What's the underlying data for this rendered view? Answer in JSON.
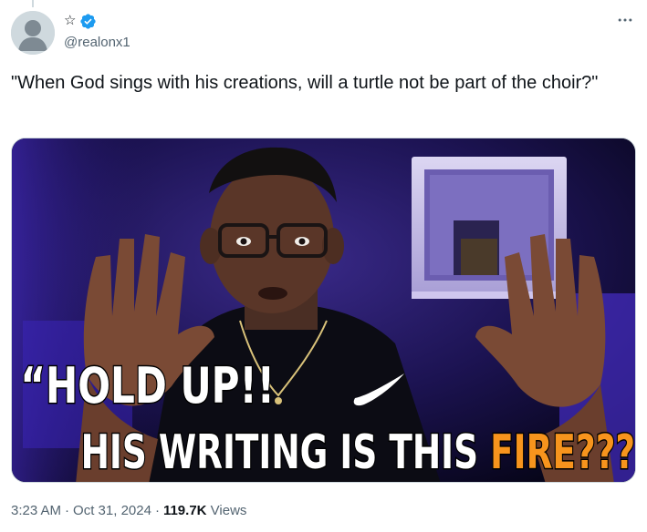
{
  "author": {
    "display_name": "☆",
    "handle": "@realonx1",
    "verified": true,
    "verified_color": "#1d9bf0"
  },
  "tweet": {
    "text": "\"When God sings with his creations, will a turtle not be part of the choir?\""
  },
  "media": {
    "caption_line1": "“HOLD UP!!",
    "caption_line2_white": "HIS WRITING IS THIS ",
    "caption_line2_orange": "FIRE???",
    "caption_line2_close": "”",
    "caption_color": "#ffffff",
    "highlight_color": "#f7941d"
  },
  "meta": {
    "time": "3:23 AM",
    "date": "Oct 31, 2024",
    "views_count": "119.7K",
    "views_label": "Views",
    "separator": "·"
  },
  "icons": {
    "more": "more-horizontal-icon",
    "verified": "verified-badge-icon",
    "avatar": "default-avatar-icon"
  }
}
